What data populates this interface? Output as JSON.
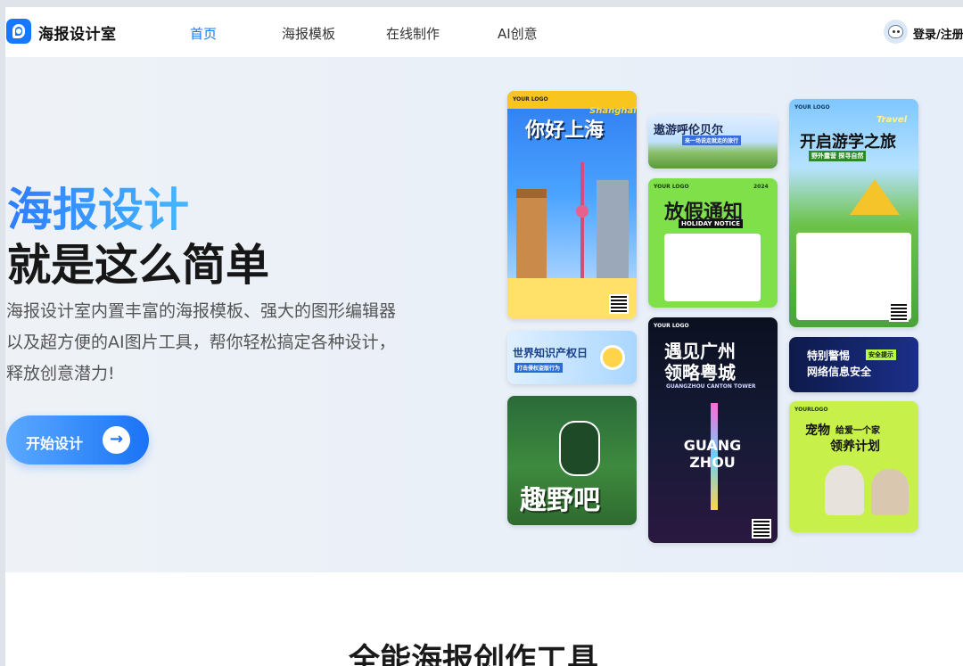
{
  "brand": {
    "name": "海报设计室"
  },
  "nav": {
    "items": [
      "首页",
      "海报模板",
      "在线制作",
      "AI创意"
    ],
    "login": "登录/注册"
  },
  "hero": {
    "title1": "海报设计",
    "title2": "就是这么简单",
    "description": "海报设计室内置丰富的海报模板、强大的图形编辑器以及超方便的AI图片工具，帮你轻松搞定各种设计，释放创意潜力!",
    "start_button": "开始设计"
  },
  "posters": {
    "shanghai": {
      "logo": "YOUR LOGO",
      "title": "你好上海",
      "script": "Shanghai"
    },
    "hulunbuir": {
      "title": "遨游呼伦贝尔",
      "subtitle": "来一场说走就走的旅行"
    },
    "holiday": {
      "logo": "YOUR LOGO",
      "year": "2024",
      "title": "放假通知",
      "subtitle": "HOLIDAY NOTICE"
    },
    "study_tour": {
      "logo": "YOUR LOGO",
      "script": "Travel",
      "title": "开启游学之旅",
      "subtitle": "野外露营 探寻自然"
    },
    "ip_day": {
      "title": "世界知识产权日",
      "subtitle": "打击侵权盗版行为"
    },
    "guangzhou": {
      "logo": "YOUR LOGO",
      "title": "遇见广州",
      "title2": "领略粤城",
      "en": "GUANGZHOU CANTON TOWER",
      "big": "GUANG ZHOU"
    },
    "security": {
      "title": "特别警惕",
      "title2": "网络信息安全",
      "badge": "安全提示"
    },
    "wild": {
      "title": "趣野吧"
    },
    "pet": {
      "logo": "YOURLOGO",
      "title": "宠物",
      "title2": "给爱一个家",
      "title3": "领养计划"
    }
  },
  "section": {
    "title": "全能海报创作工具"
  },
  "colors": {
    "accent": "#1677ff"
  }
}
